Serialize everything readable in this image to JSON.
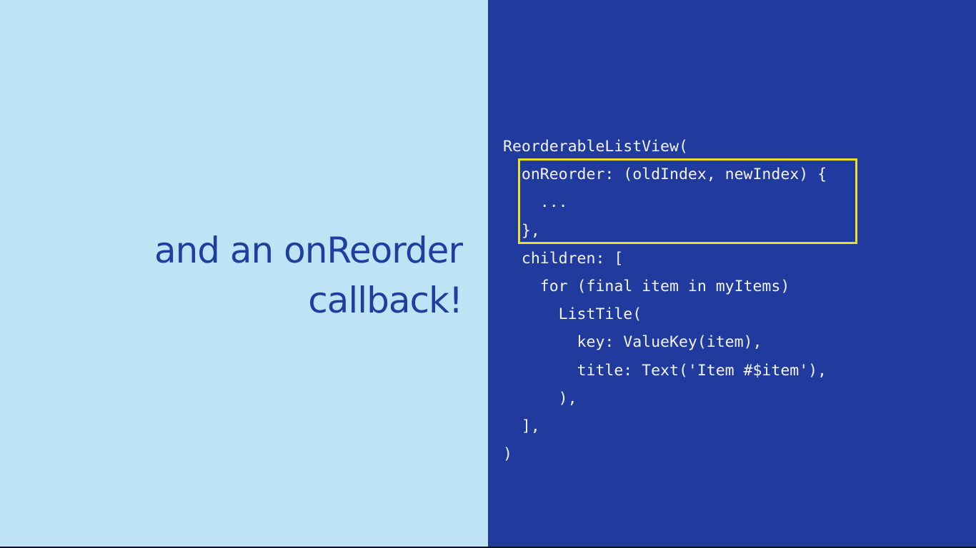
{
  "headline": {
    "line1": "and an onReorder",
    "line2": "callback!"
  },
  "code_lines": [
    "ReorderableListView(",
    "  onReorder: (oldIndex, newIndex) {",
    "    ...",
    "  },",
    "  children: [",
    "    for (final item in myItems)",
    "      ListTile(",
    "        key: ValueKey(item),",
    "        title: Text('Item #$item'),",
    "      ),",
    "  ],",
    ")"
  ],
  "colors": {
    "left_background": "#bde3f5",
    "headline_text": "#1f3fa0",
    "right_background": "#213a9e",
    "code_text": "#f1f3fb",
    "highlight_border": "#e8e02a"
  }
}
